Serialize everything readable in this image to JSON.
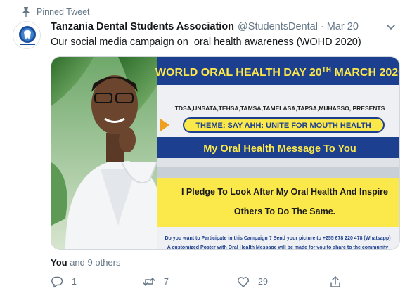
{
  "pinned": {
    "label": "Pinned Tweet",
    "icon": "pin-icon"
  },
  "tweet": {
    "author_name": "Tanzania Dental Students Association",
    "handle": "@StudentsDental",
    "separator": "·",
    "time": "Mar 20",
    "text": "Our social media campaign on  oral health awareness (WOHD 2020)"
  },
  "poster": {
    "title": "WORLD ORAL HEALTH DAY 20",
    "title_sup": "TH",
    "title_end": " MARCH 2020",
    "presenters": "TDSA,UNSATA,TEHSA,TAMSA,TAMELASA,TAPSA,MUHASSO, PRESENTS",
    "theme": "THEME: SAY AHH: UNITE FOR MOUTH HEALTH",
    "message_title": "My Oral Health Message To You",
    "pledge_line1": "I Pledge To Look After My Oral Health And Inspire",
    "pledge_line2": "Others To Do The Same.",
    "footer_line1": "Do you want to Participate in this Campaign ? Send your picture to +255 678 220 478 (Whatsapp)",
    "footer_line2": "A customized Poster with Oral Health Message will be made for you to share to the community",
    "colors": {
      "navy": "#1d3f8f",
      "yellow": "#fbe84a",
      "orange": "#f0a020"
    }
  },
  "liked_by": {
    "you": "You",
    "rest": " and 9 others"
  },
  "actions": {
    "reply_count": "1",
    "retweet_count": "7",
    "like_count": "29"
  },
  "colors": {
    "secondary_text": "#657786",
    "primary_text": "#14171a"
  }
}
